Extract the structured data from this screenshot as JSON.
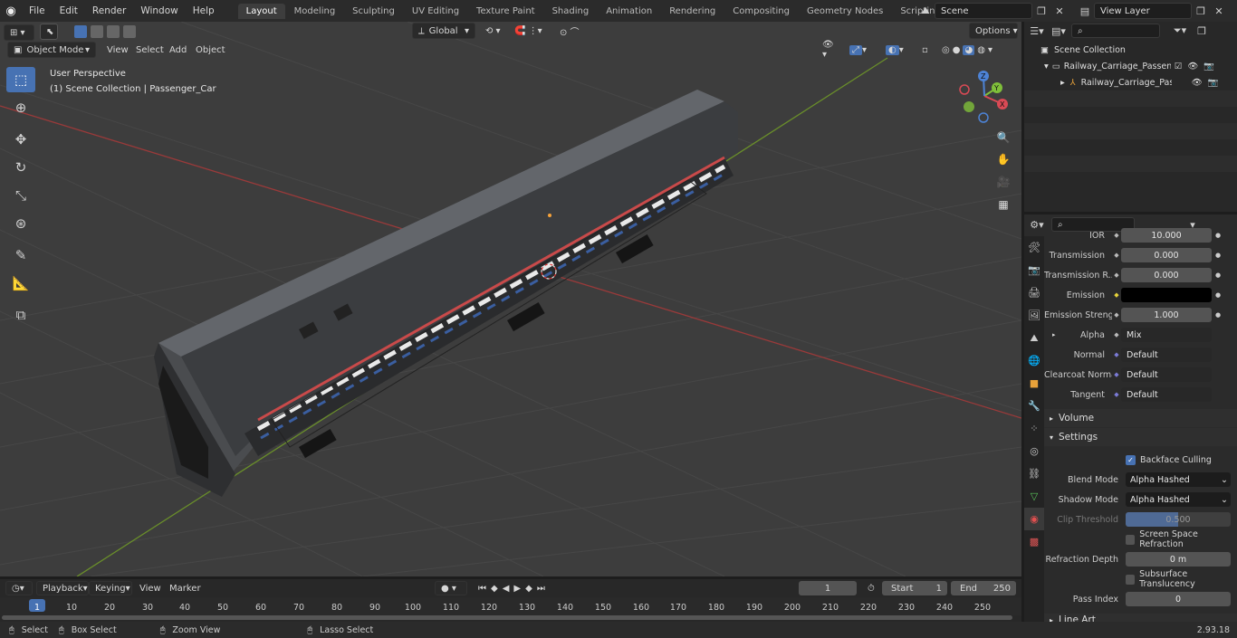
{
  "topbar": {
    "menus": [
      "File",
      "Edit",
      "Render",
      "Window",
      "Help"
    ],
    "workspaces": [
      "Layout",
      "Modeling",
      "Sculpting",
      "UV Editing",
      "Texture Paint",
      "Shading",
      "Animation",
      "Rendering",
      "Compositing",
      "Geometry Nodes",
      "Scripting"
    ],
    "active_workspace": "Layout",
    "add_tab": "+",
    "scene": "Scene",
    "view_layer": "View Layer"
  },
  "viewport": {
    "mode": "Object Mode",
    "menus": [
      "View",
      "Select",
      "Add",
      "Object"
    ],
    "transform_orientation": "Global",
    "options": "Options",
    "overlay_title": "User Perspective",
    "overlay_collection": "(1) Scene Collection | Passenger_Car",
    "gizmo": {
      "x": "X",
      "y": "Y",
      "z": "Z"
    }
  },
  "outliner": {
    "root": "Scene Collection",
    "items": [
      {
        "label": "Railway_Carriage_Passenger_"
      },
      {
        "label": "Railway_Carriage_Passen"
      }
    ]
  },
  "properties": {
    "rows": [
      {
        "label": "IOR",
        "value": "10.000",
        "type": "number"
      },
      {
        "label": "Transmission",
        "value": "0.000",
        "type": "number"
      },
      {
        "label": "Transmission R...",
        "value": "0.000",
        "type": "number"
      },
      {
        "label": "Emission",
        "value": "",
        "type": "color"
      },
      {
        "label": "Emission Strengt",
        "value": "1.000",
        "type": "number"
      },
      {
        "label": "Alpha",
        "value": "Mix",
        "type": "socket"
      },
      {
        "label": "Normal",
        "value": "Default",
        "type": "socket"
      },
      {
        "label": "Clearcoat Normal",
        "value": "Default",
        "type": "socket"
      },
      {
        "label": "Tangent",
        "value": "Default",
        "type": "socket"
      }
    ],
    "sections": {
      "volume": "Volume",
      "settings": "Settings",
      "line_art": "Line Art"
    },
    "settings": {
      "backface_culling": "Backface Culling",
      "blend_mode_label": "Blend Mode",
      "blend_mode": "Alpha Hashed",
      "shadow_mode_label": "Shadow Mode",
      "shadow_mode": "Alpha Hashed",
      "clip_threshold_label": "Clip Threshold",
      "clip_threshold": "0.500",
      "screen_space_refraction": "Screen Space Refraction",
      "refraction_depth_label": "Refraction Depth",
      "refraction_depth": "0 m",
      "subsurface_translucency": "Subsurface Translucency",
      "pass_index_label": "Pass Index",
      "pass_index": "0"
    }
  },
  "timeline": {
    "menus": [
      "Playback",
      "Keying",
      "View",
      "Marker"
    ],
    "current_frame": "1",
    "start_label": "Start",
    "start": "1",
    "end_label": "End",
    "end": "250",
    "ruler": [
      "1",
      "10",
      "20",
      "30",
      "40",
      "50",
      "60",
      "70",
      "80",
      "90",
      "100",
      "110",
      "120",
      "130",
      "140",
      "150",
      "160",
      "170",
      "180",
      "190",
      "200",
      "210",
      "220",
      "230",
      "240",
      "250"
    ]
  },
  "statusbar": {
    "select": "Select",
    "box_select": "Box Select",
    "zoom_view": "Zoom View",
    "lasso_select": "Lasso Select",
    "version": "2.93.18"
  }
}
